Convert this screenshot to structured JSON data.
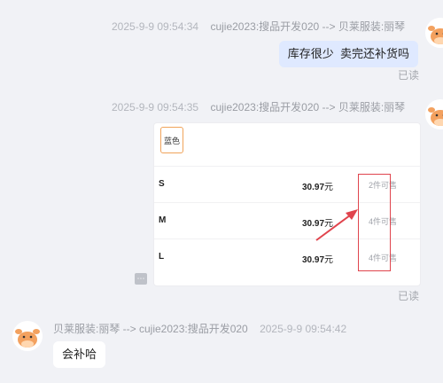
{
  "messages": [
    {
      "timestamp": "2025-9-9 09:54:34",
      "route": "cujie2023:搜品开发020 --> 贝莱服装:丽琴",
      "text": "库存很少  卖完还补货吗",
      "status": "已读"
    },
    {
      "timestamp": "2025-9-9 09:54:35",
      "route": "cujie2023:搜品开发020 --> 贝莱服装:丽琴",
      "card": {
        "color_label": "蓝色",
        "rows": [
          {
            "size": "S",
            "price": "30.97",
            "unit": "元",
            "stock": "2件可售"
          },
          {
            "size": "M",
            "price": "30.97",
            "unit": "元",
            "stock": "4件可售"
          },
          {
            "size": "L",
            "price": "30.97",
            "unit": "元",
            "stock": "4件可售"
          }
        ]
      },
      "status": "已读"
    },
    {
      "route": "贝莱服装:丽琴 --> cujie2023:搜品开发020",
      "timestamp": "2025-9-9 09:54:42",
      "text": "会补哈"
    }
  ],
  "more_button": "⋯",
  "colors": {
    "background": "#f1f2f6",
    "my_bubble": "#dfe9ff",
    "their_bubble": "#ffffff",
    "annotation_red": "#e0444d"
  }
}
